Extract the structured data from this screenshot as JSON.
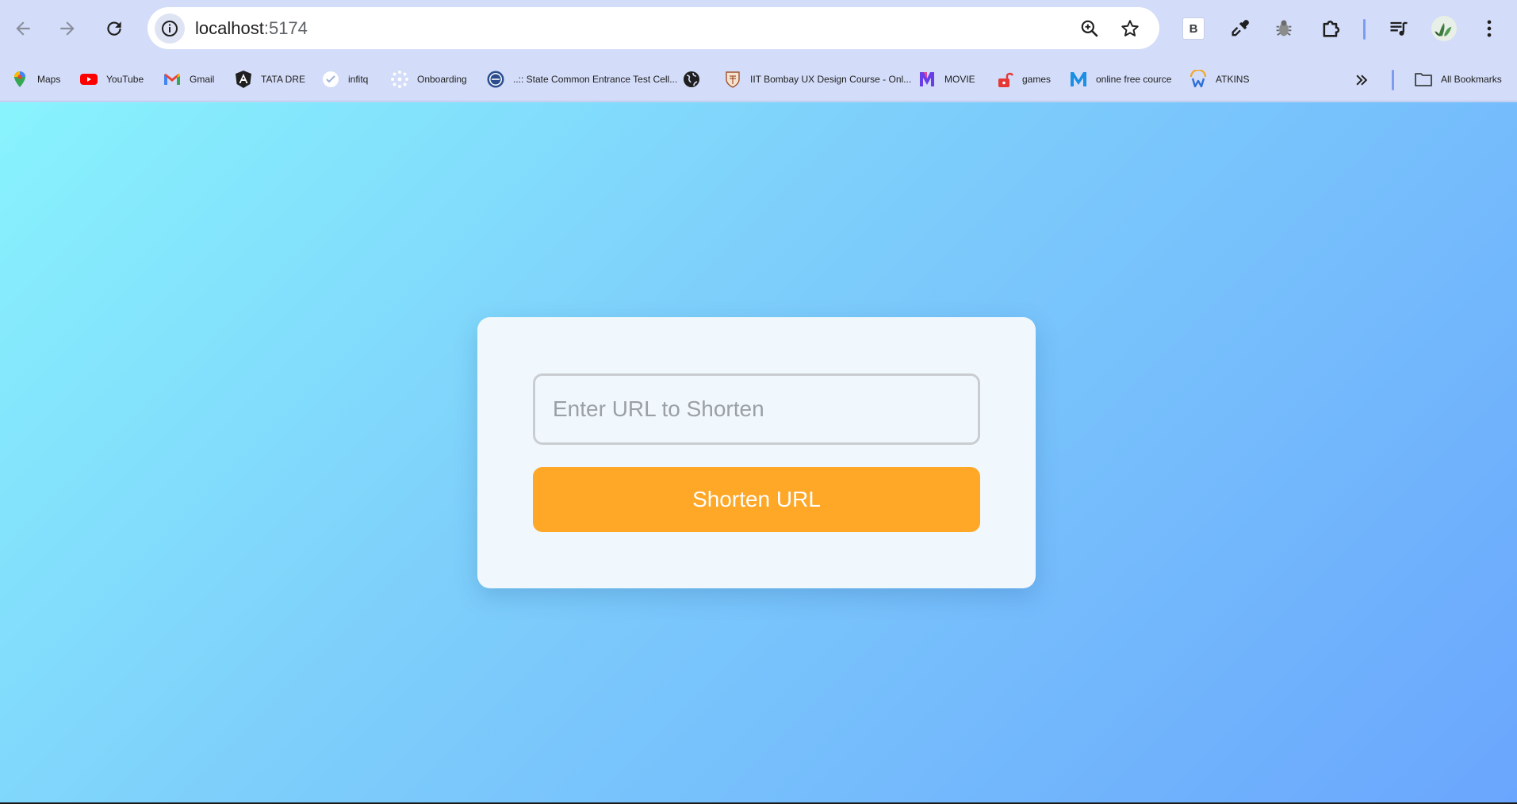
{
  "browser": {
    "address": {
      "host": "localhost",
      "port": ":5174"
    },
    "extension_label": "B",
    "colors": {
      "chrome_bg": "#d3dcf8",
      "accent": "#7e9cee"
    }
  },
  "bookmarks": {
    "items": [
      {
        "label": "Maps",
        "icon": "maps-icon"
      },
      {
        "label": "YouTube",
        "icon": "youtube-icon"
      },
      {
        "label": "Gmail",
        "icon": "gmail-icon"
      },
      {
        "label": "TATA DRE",
        "icon": "angular-icon"
      },
      {
        "label": "infitq",
        "icon": "infitq-icon"
      },
      {
        "label": "Onboarding",
        "icon": "onboarding-icon"
      },
      {
        "label": "..:: State Common Entrance Test Cell...",
        "icon": "cet-icon"
      },
      {
        "label": "",
        "icon": "globe-icon"
      },
      {
        "label": "IIT Bombay UX Design Course - Onl...",
        "icon": "iit-icon"
      },
      {
        "label": "MOVIE",
        "icon": "movie-m-icon"
      },
      {
        "label": "games",
        "icon": "lock-icon"
      },
      {
        "label": "online free cource",
        "icon": "m-icon"
      },
      {
        "label": "ATKINS",
        "icon": "w-icon"
      }
    ],
    "all_bookmarks": "All Bookmarks"
  },
  "app": {
    "input_placeholder": "Enter URL to Shorten",
    "input_value": "",
    "button_label": "Shorten URL",
    "colors": {
      "button": "#ffa726",
      "card": "#f1f8fd",
      "bg_start": "#88f3fd",
      "bg_end": "#6aa6fd"
    }
  }
}
